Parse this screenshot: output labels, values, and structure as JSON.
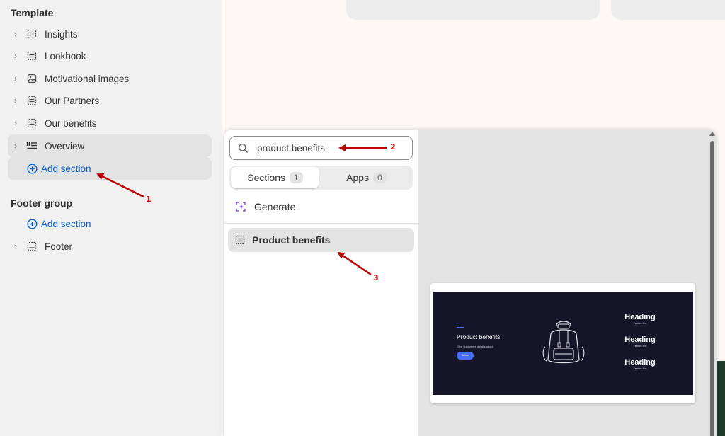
{
  "sidebar": {
    "template_title": "Template",
    "template_items": [
      {
        "label": "Insights",
        "icon": "section-icon"
      },
      {
        "label": "Lookbook",
        "icon": "section-icon"
      },
      {
        "label": "Motivational images",
        "icon": "image-icon"
      },
      {
        "label": "Our Partners",
        "icon": "section-icon"
      },
      {
        "label": "Our benefits",
        "icon": "section-icon"
      },
      {
        "label": "Overview",
        "icon": "text-section-icon"
      }
    ],
    "add_section_label": "Add section",
    "footer_title": "Footer group",
    "footer_add_label": "Add section",
    "footer_items": [
      {
        "label": "Footer",
        "icon": "footer-icon"
      }
    ]
  },
  "popover": {
    "search": {
      "value": "product benefits"
    },
    "tabs": [
      {
        "label": "Sections",
        "count": "1",
        "selected": true
      },
      {
        "label": "Apps",
        "count": "0",
        "selected": false
      }
    ],
    "generate_label": "Generate",
    "results": [
      {
        "label": "Product benefits",
        "icon": "section-icon"
      }
    ],
    "preview": {
      "title": "Product benefits",
      "subtitle": "Give customers details about",
      "button": "Button",
      "features": [
        {
          "heading": "Heading",
          "text": "Feature text"
        },
        {
          "heading": "Heading",
          "text": "Feature text"
        },
        {
          "heading": "Heading",
          "text": "Feature text"
        }
      ]
    }
  },
  "annotations": {
    "a1": "1",
    "a2": "2",
    "a3": "3"
  },
  "colors": {
    "accent": "#005bd3",
    "annotation": "#c00000",
    "preview_bg": "#17152a",
    "generate_icon": "#8a4dff"
  }
}
